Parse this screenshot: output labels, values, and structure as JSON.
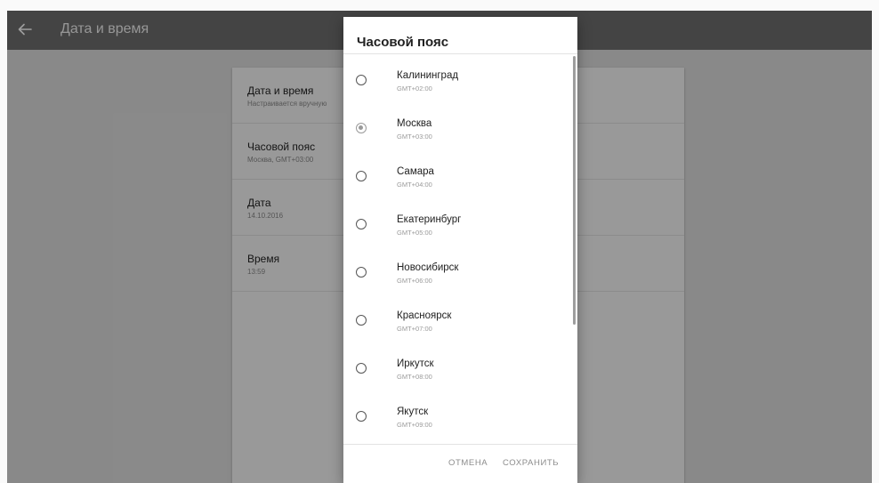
{
  "appbar": {
    "title": "Дата и время",
    "back_icon": "arrow-left-icon"
  },
  "settings": [
    {
      "title": "Дата и время",
      "subtitle": "Настраивается вручную"
    },
    {
      "title": "Часовой пояс",
      "subtitle": "Москва, GMT+03:00"
    },
    {
      "title": "Дата",
      "subtitle": "14.10.2016"
    },
    {
      "title": "Время",
      "subtitle": "13:59"
    }
  ],
  "dialog": {
    "title": "Часовой пояс",
    "options": [
      {
        "name": "Калининград",
        "offset": "GMT+02:00",
        "selected": false
      },
      {
        "name": "Москва",
        "offset": "GMT+03:00",
        "selected": true
      },
      {
        "name": "Самара",
        "offset": "GMT+04:00",
        "selected": false
      },
      {
        "name": "Екатеринбург",
        "offset": "GMT+05:00",
        "selected": false
      },
      {
        "name": "Новосибирск",
        "offset": "GMT+06:00",
        "selected": false
      },
      {
        "name": "Красноярск",
        "offset": "GMT+07:00",
        "selected": false
      },
      {
        "name": "Иркутск",
        "offset": "GMT+08:00",
        "selected": false
      },
      {
        "name": "Якутск",
        "offset": "GMT+09:00",
        "selected": false
      }
    ],
    "cancel_label": "ОТМЕНА",
    "save_label": "СОХРАНИТЬ"
  },
  "colors": {
    "appbar": "#6f6f6f",
    "scrim": "#000000",
    "dialog_bg": "#ffffff",
    "radio_selected": "#9a9a9a",
    "button_text": "#8c8c8c"
  }
}
